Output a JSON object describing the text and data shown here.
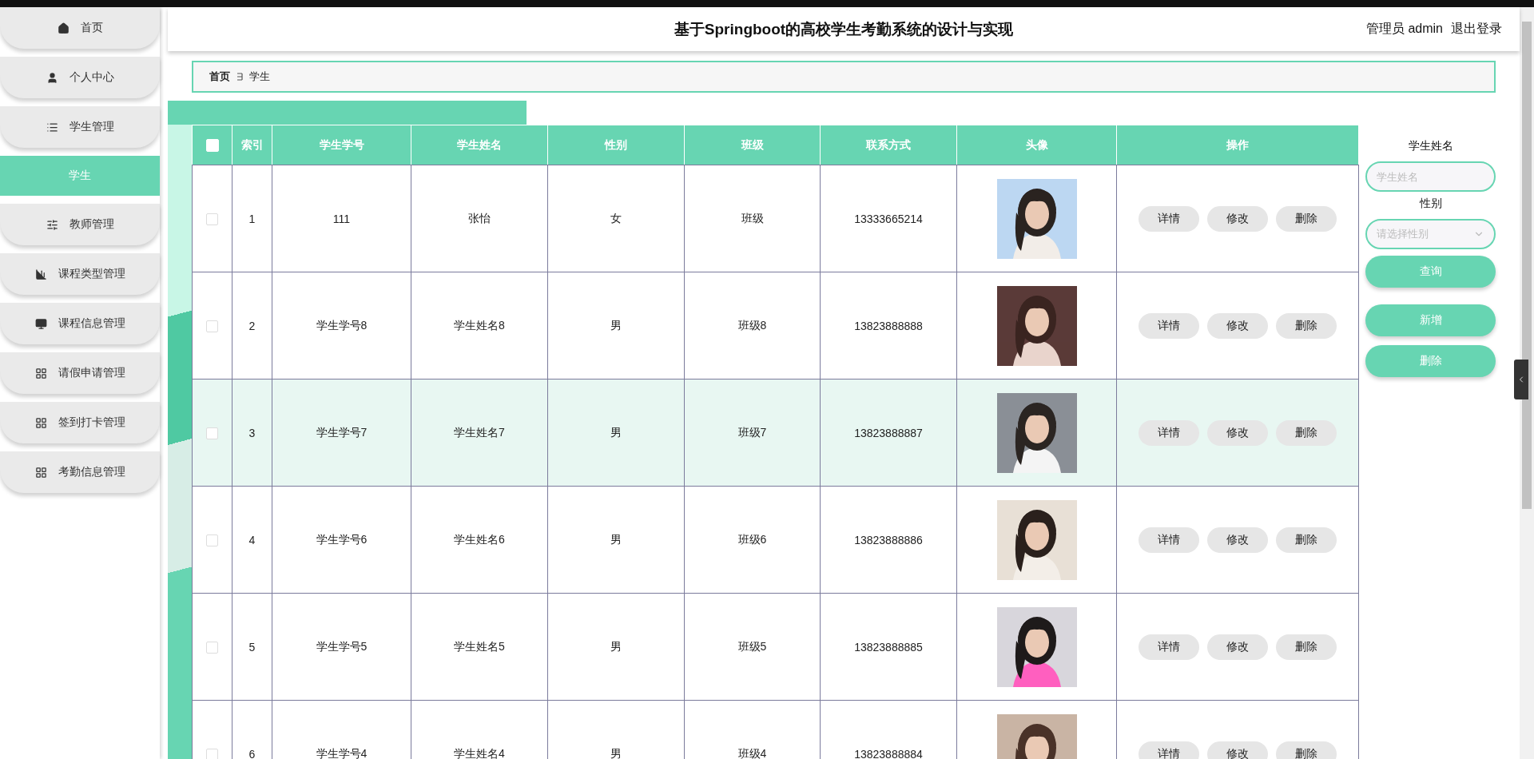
{
  "sidebar": {
    "items": [
      {
        "label": "首页",
        "selected": false
      },
      {
        "label": "个人中心",
        "selected": false
      },
      {
        "label": "学生管理",
        "selected": false,
        "expanded": true,
        "children": [
          {
            "label": "学生",
            "selected": true
          }
        ]
      },
      {
        "label": "教师管理",
        "selected": false
      },
      {
        "label": "课程类型管理",
        "selected": false
      },
      {
        "label": "课程信息管理",
        "selected": false
      },
      {
        "label": "请假申请管理",
        "selected": false
      },
      {
        "label": "签到打卡管理",
        "selected": false
      },
      {
        "label": "考勤信息管理",
        "selected": false
      }
    ]
  },
  "header": {
    "title": "基于Springboot的高校学生考勤系统的设计与实现",
    "user": "管理员 admin",
    "logout": "退出登录"
  },
  "breadcrumb": [
    "首页",
    "学生"
  ],
  "table": {
    "header_checkbox": {
      "checked": false
    },
    "columns": [
      "索引",
      "学生学号",
      "学生姓名",
      "性别",
      "班级",
      "联系方式",
      "头像",
      "操作"
    ],
    "rows": [
      {
        "checked": false,
        "highlighted": false,
        "index": "1",
        "student_no": "111",
        "name": "张怡",
        "gender": "女",
        "class": "班级",
        "phone": "13333665214",
        "actions": [
          "详情",
          "修改",
          "删除"
        ]
      },
      {
        "checked": false,
        "highlighted": false,
        "index": "2",
        "student_no": "学生学号8",
        "name": "学生姓名8",
        "gender": "男",
        "class": "班级8",
        "phone": "13823888888",
        "actions": [
          "详情",
          "修改",
          "删除"
        ]
      },
      {
        "checked": false,
        "highlighted": true,
        "index": "3",
        "student_no": "学生学号7",
        "name": "学生姓名7",
        "gender": "男",
        "class": "班级7",
        "phone": "13823888887",
        "actions": [
          "详情",
          "修改",
          "删除"
        ]
      },
      {
        "checked": false,
        "highlighted": false,
        "index": "4",
        "student_no": "学生学号6",
        "name": "学生姓名6",
        "gender": "男",
        "class": "班级6",
        "phone": "13823888886",
        "actions": [
          "详情",
          "修改",
          "删除"
        ]
      },
      {
        "checked": false,
        "highlighted": false,
        "index": "5",
        "student_no": "学生学号5",
        "name": "学生姓名5",
        "gender": "男",
        "class": "班级5",
        "phone": "13823888885",
        "actions": [
          "详情",
          "修改",
          "删除"
        ]
      },
      {
        "checked": false,
        "highlighted": false,
        "index": "6",
        "student_no": "学生学号4",
        "name": "学生姓名4",
        "gender": "男",
        "class": "班级4",
        "phone": "13823888884",
        "actions": [
          "详情",
          "修改",
          "删除"
        ]
      }
    ]
  },
  "search": {
    "fields": [
      {
        "kind": "text",
        "label": "学生姓名",
        "placeholder": "学生姓名"
      },
      {
        "kind": "select",
        "label": "性别",
        "placeholder": "请选择性别"
      }
    ],
    "search_button": "查询",
    "actions": [
      "新增",
      "删除"
    ]
  }
}
